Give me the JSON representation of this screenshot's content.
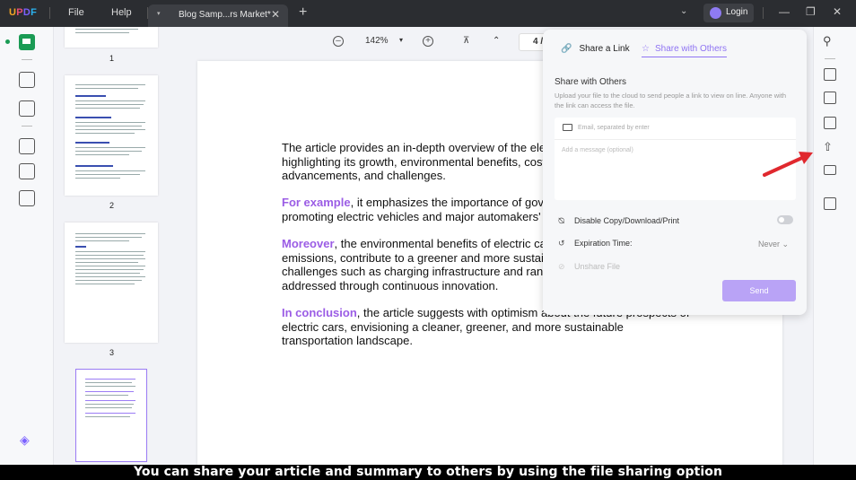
{
  "app": {
    "logo": {
      "u": "U",
      "p": "P",
      "d": "D",
      "f": "F"
    },
    "menu": [
      "File",
      "Help"
    ],
    "tab_title": "Blog Samp...rs Market*",
    "login_label": "Login"
  },
  "thumbnails": [
    {
      "number": "1"
    },
    {
      "number": "2"
    },
    {
      "number": "3"
    }
  ],
  "toolbar": {
    "zoom": "142%",
    "page_input": "4 /"
  },
  "document": {
    "p1": [
      "The article provides an in-depth overview of the elec",
      "highlighting its growth, environmental benefits, cost",
      "advancements, and challenges."
    ],
    "p2_kw": "For example",
    "p2": [
      ", it emphasizes the importance of gove",
      "promoting electric vehicles and major automakers' c"
    ],
    "p3_kw": "Moreover",
    "p3": [
      ", the environmental benefits of electric car",
      "emissions, contribute to a greener and more sustair",
      "challenges such as charging infrastructure and rang",
      "addressed through continuous innovation."
    ],
    "p4_kw": "In conclusion",
    "p4": [
      ", the article suggests with optimism about the future prospects of",
      "electric cars, envisioning a cleaner, greener, and more sustainable",
      "transportation landscape."
    ]
  },
  "share_panel": {
    "tab_link": "Share a Link",
    "tab_others": "Share with Others",
    "title": "Share with Others",
    "description": "Upload your file to the cloud to send people a link to view on line. Anyone with the link can access the file.",
    "email_placeholder": "Email, separated by enter",
    "message_placeholder": "Add a message (optional)",
    "disable_label": "Disable Copy/Download/Print",
    "expiration_label": "Expiration Time:",
    "expiration_value": "Never",
    "unshare_label": "Unshare File",
    "send_label": "Send"
  },
  "caption": "You can share your article and summary to others by using the file sharing option",
  "colors": {
    "accent": "#8f74f3",
    "keyword": "#9b5de5",
    "annotation_arrow": "#e0282e",
    "active_tool": "#1a9b54"
  }
}
